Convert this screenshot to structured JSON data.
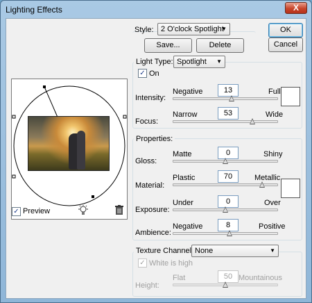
{
  "window": {
    "title": "Lighting Effects",
    "close_label": "X"
  },
  "style": {
    "label": "Style:",
    "value": "2 O'clock Spotlight",
    "save_label": "Save...",
    "delete_label": "Delete"
  },
  "buttons": {
    "ok_label": "OK",
    "cancel_label": "Cancel"
  },
  "light_type": {
    "label": "Light Type:",
    "value": "Spotlight",
    "on_label": "On",
    "on_checked": true,
    "intensity": {
      "label": "Intensity:",
      "min_label": "Negative",
      "max_label": "Full",
      "value": "13",
      "fraction": 0.56
    },
    "focus": {
      "label": "Focus:",
      "min_label": "Narrow",
      "max_label": "Wide",
      "value": "53",
      "fraction": 0.76
    },
    "color": "#ffffff"
  },
  "properties": {
    "title": "Properties:",
    "gloss": {
      "label": "Gloss:",
      "min_label": "Matte",
      "max_label": "Shiny",
      "value": "0",
      "fraction": 0.5
    },
    "material": {
      "label": "Material:",
      "min_label": "Plastic",
      "max_label": "Metallic",
      "value": "70",
      "fraction": 0.85
    },
    "exposure": {
      "label": "Exposure:",
      "min_label": "Under",
      "max_label": "Over",
      "value": "0",
      "fraction": 0.5
    },
    "ambience": {
      "label": "Ambience:",
      "min_label": "Negative",
      "max_label": "Positive",
      "value": "8",
      "fraction": 0.54
    },
    "color": "#ffffff"
  },
  "texture": {
    "label": "Texture Channel:",
    "value": "None",
    "white_is_high_label": "White is high",
    "white_is_high_checked": true,
    "height": {
      "label": "Height:",
      "min_label": "Flat",
      "max_label": "Mountainous",
      "value": "50",
      "fraction": 0.5
    }
  },
  "preview": {
    "label": "Preview",
    "checked": true
  },
  "icons": {
    "bulb": "light-bulb-icon",
    "trash": "trash-icon"
  },
  "colors": {
    "accent": "#3c7fb1",
    "titlebar": "#a9c9e4",
    "close": "#c8462b"
  }
}
